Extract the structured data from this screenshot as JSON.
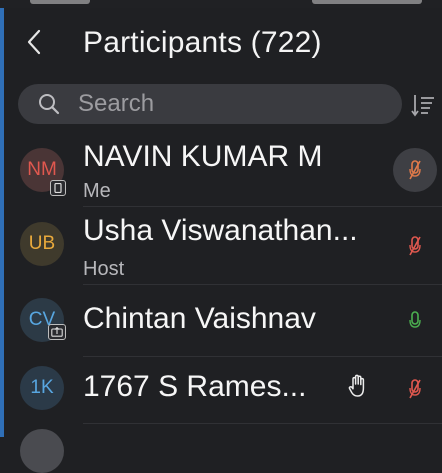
{
  "header": {
    "title": "Participants (722)"
  },
  "search": {
    "placeholder": "Search"
  },
  "participants": [
    {
      "initials": "NM",
      "name": "NAVIN KUMAR M",
      "subtitle": "Me",
      "avatar_color": "#e0584f",
      "avatar_bg": "#4a3536",
      "mic_state": "muted",
      "mic_color": "#e07a4a"
    },
    {
      "initials": "UB",
      "name": "Usha Viswanathan...",
      "subtitle": "Host",
      "avatar_color": "#e8a93c",
      "avatar_bg": "#3f3a2c",
      "mic_state": "muted",
      "mic_color": "#e0584f"
    },
    {
      "initials": "CV",
      "name": "Chintan Vaishnav",
      "subtitle": "",
      "avatar_color": "#58a6e0",
      "avatar_bg": "#2c3a46",
      "mic_state": "unmuted",
      "mic_color": "#4caf50"
    },
    {
      "initials": "1K",
      "name": "1767 S Rames...",
      "subtitle": "",
      "avatar_color": "#58a6e0",
      "avatar_bg": "#2b3a48",
      "mic_state": "muted",
      "mic_color": "#e0584f"
    }
  ],
  "icons": [
    "back-arrow-icon",
    "search-icon",
    "sort-icon",
    "phone-icon",
    "share-screen-icon",
    "raised-hand-icon",
    "mic-muted-icon",
    "mic-icon"
  ]
}
